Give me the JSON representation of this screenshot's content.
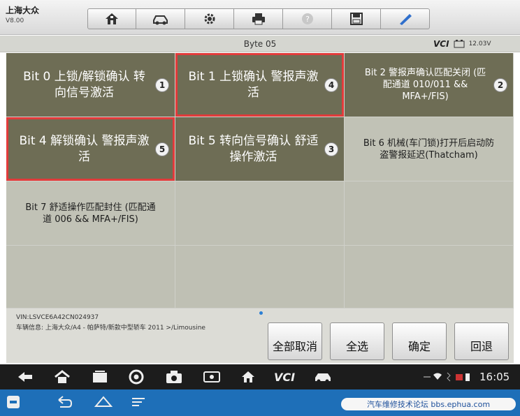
{
  "header": {
    "brand": "上海大众",
    "version": "V8.00",
    "toolbar": [
      {
        "name": "home-icon"
      },
      {
        "name": "car-settings-icon"
      },
      {
        "name": "gear-icon"
      },
      {
        "name": "printer-icon"
      },
      {
        "name": "help-icon"
      },
      {
        "name": "save-icon"
      },
      {
        "name": "pen-icon"
      }
    ]
  },
  "status": {
    "page_title": "Byte 05",
    "vci_label": "VCI",
    "battery_voltage": "12.03V"
  },
  "grid": {
    "cells": [
      {
        "label": "Bit 0 上锁/解锁确认 转向信号激活",
        "selected": true,
        "order": "1",
        "highlight": false
      },
      {
        "label": "Bit 1 上锁确认 警报声激活",
        "selected": true,
        "order": "4",
        "highlight": true
      },
      {
        "label": "Bit 2 警报声确认匹配关闭 (匹配通道 010/011 && MFA+/FIS)",
        "selected": true,
        "order": "2",
        "highlight": false
      },
      {
        "label": "Bit 4 解锁确认 警报声激活",
        "selected": true,
        "order": "5",
        "highlight": true
      },
      {
        "label": "Bit 5 转向信号确认 舒适 操作激活",
        "selected": true,
        "order": "3",
        "highlight": false
      },
      {
        "label": "Bit 6 机械(车门锁)打开后启动防盗警报延迟(Thatcham)",
        "selected": false,
        "order": "",
        "highlight": false
      },
      {
        "label": "Bit 7 舒适操作匹配封住 (匹配通道 006 && MFA+/FIS)",
        "selected": false,
        "order": "",
        "highlight": false
      }
    ]
  },
  "footer": {
    "vin": "VIN:LSVCE6A42CN024937",
    "vehicle_info": "车辆信息: 上海大众/A4 - 帕萨特/新款中型轿车 2011 >/Limousine",
    "buttons": {
      "deselect_all": "全部取消",
      "select_all": "全选",
      "confirm": "确定",
      "back": "回退"
    }
  },
  "system": {
    "clock": "16:05",
    "vci_label": "VCI",
    "watermark": "汽车维修技术论坛 bbs.ephua.com"
  },
  "colors": {
    "selected_cell": "#6e6d55",
    "unselected_cell": "#c1c2b6",
    "highlight": "#e23b3b",
    "android_blue": "#1e6fb8"
  }
}
